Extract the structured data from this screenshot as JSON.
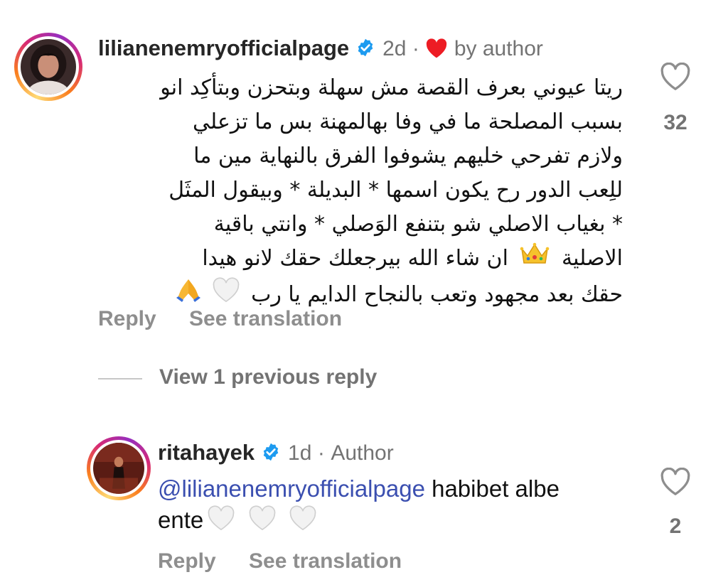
{
  "comment": {
    "username": "lilianenemryofficialpage",
    "time": "2d",
    "separator": "·",
    "liked_label": "by author",
    "text_lines": [
      "ريتا عيوني بعرف القصة مش سهلة وبتحزن وبتأكِد انو",
      "بسبب المصلحة ما في وفا بهالمهنة بس ما تزعلي",
      "ولازم تفرحي خليهم يشوفوا الفرق بالنهاية مين ما",
      "للِعب الدور رح يكون اسمها * البديلة * وبيقول المثَل",
      "* بغياب الاصلي شو بتنفع الوَصلي * وانتي باقية",
      "الاصلية",
      "ان شاء الله بيرجعلك حقك لانو هيدا",
      "حقك بعد مجهود وتعب بالنجاح الدايم يا رب"
    ],
    "like_count": "32",
    "reply_label": "Reply",
    "translate_label": "See translation"
  },
  "view_replies_label": "View 1 previous reply",
  "reply": {
    "username": "ritahayek",
    "time": "1d",
    "separator": "·",
    "author_label": "Author",
    "mention": "@lilianenemryofficialpage",
    "text_part1": " habibet albe",
    "text_part2": "ente",
    "like_count": "2",
    "reply_label": "Reply",
    "translate_label": "See translation"
  },
  "colors": {
    "verified": "#1d9bf0",
    "heart": "#ed1c24",
    "mention": "#3b4fb0",
    "muted": "#8e8e8e"
  },
  "icons": [
    "verified-icon",
    "heart-icon",
    "like-outline-icon",
    "crown-emoji",
    "white-heart-emoji",
    "folded-hands-emoji"
  ]
}
